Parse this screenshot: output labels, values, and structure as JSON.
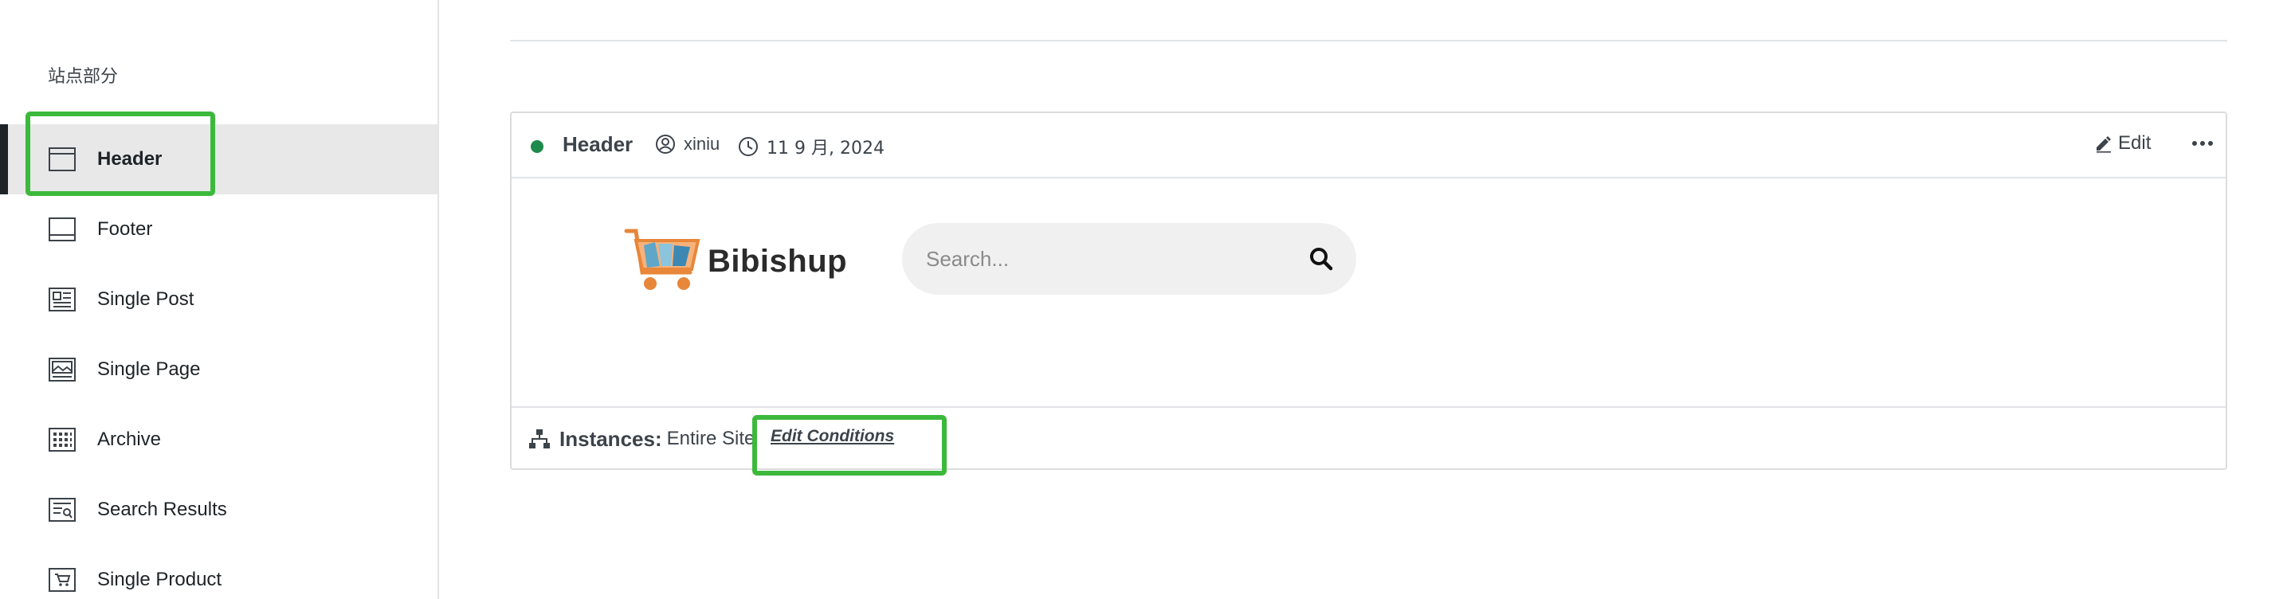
{
  "sidebar": {
    "heading": "站点部分",
    "items": [
      {
        "label": "Header",
        "icon": "header-layout-icon",
        "active": true
      },
      {
        "label": "Footer",
        "icon": "footer-layout-icon",
        "active": false
      },
      {
        "label": "Single Post",
        "icon": "single-post-icon",
        "active": false
      },
      {
        "label": "Single Page",
        "icon": "single-page-icon",
        "active": false
      },
      {
        "label": "Archive",
        "icon": "archive-icon",
        "active": false
      },
      {
        "label": "Search Results",
        "icon": "search-results-icon",
        "active": false
      },
      {
        "label": "Single Product",
        "icon": "single-product-icon",
        "active": false
      }
    ]
  },
  "card": {
    "title": "Header",
    "status_color": "#1e8a4c",
    "author": "xiniu",
    "date": "11 9 月, 2024",
    "edit_label": "Edit",
    "more_icon": "more-horizontal-icon",
    "preview": {
      "logo_text": "Bibishup",
      "search_placeholder": "Search..."
    },
    "footer": {
      "instances_label": "Instances:",
      "instances_value": "Entire Site",
      "edit_conditions_label": "Edit Conditions"
    }
  },
  "colors": {
    "highlight": "#3cb93c",
    "accent_dark": "#1d2327",
    "active_bg": "#e8e8e9"
  }
}
